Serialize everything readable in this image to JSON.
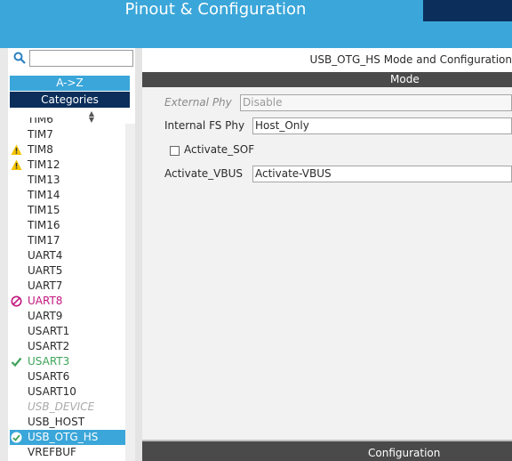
{
  "header": {
    "title": "Pinout & Configuration"
  },
  "left": {
    "search": {
      "placeholder": ""
    },
    "az_label": "A->Z",
    "categories_label": "Categories",
    "items": [
      {
        "label": "TIM6",
        "state": "normal"
      },
      {
        "label": "TIM7",
        "state": "normal"
      },
      {
        "label": "TIM8",
        "state": "warn"
      },
      {
        "label": "TIM12",
        "state": "warn"
      },
      {
        "label": "TIM13",
        "state": "normal"
      },
      {
        "label": "TIM14",
        "state": "normal"
      },
      {
        "label": "TIM15",
        "state": "normal"
      },
      {
        "label": "TIM16",
        "state": "normal"
      },
      {
        "label": "TIM17",
        "state": "normal"
      },
      {
        "label": "UART4",
        "state": "normal"
      },
      {
        "label": "UART5",
        "state": "normal"
      },
      {
        "label": "UART7",
        "state": "normal"
      },
      {
        "label": "UART8",
        "state": "error"
      },
      {
        "label": "UART9",
        "state": "normal"
      },
      {
        "label": "USART1",
        "state": "normal"
      },
      {
        "label": "USART2",
        "state": "normal"
      },
      {
        "label": "USART3",
        "state": "ok"
      },
      {
        "label": "USART6",
        "state": "normal"
      },
      {
        "label": "USART10",
        "state": "normal"
      },
      {
        "label": "USB_DEVICE",
        "state": "disabled"
      },
      {
        "label": "USB_HOST",
        "state": "normal"
      },
      {
        "label": "USB_OTG_HS",
        "state": "selected"
      },
      {
        "label": "VREFBUF",
        "state": "normal"
      }
    ]
  },
  "right": {
    "mode_title": "USB_OTG_HS Mode and Configuration",
    "mode_bar": "Mode",
    "external_phy": {
      "label": "External Phy",
      "value": "Disable"
    },
    "internal_fs_phy": {
      "label": "Internal FS Phy",
      "value": "Host_Only"
    },
    "activate_sof": {
      "label": "Activate_SOF",
      "checked": false
    },
    "activate_vbus": {
      "label": "Activate_VBUS",
      "value": "Activate-VBUS"
    },
    "config_bar": "Configuration"
  },
  "colors": {
    "header": "#3aa6d9",
    "header_dark": "#0b2e5a",
    "bar": "#4a4a4a",
    "warn": "#f4c400",
    "error": "#c2177e",
    "ok": "#3da35a"
  }
}
